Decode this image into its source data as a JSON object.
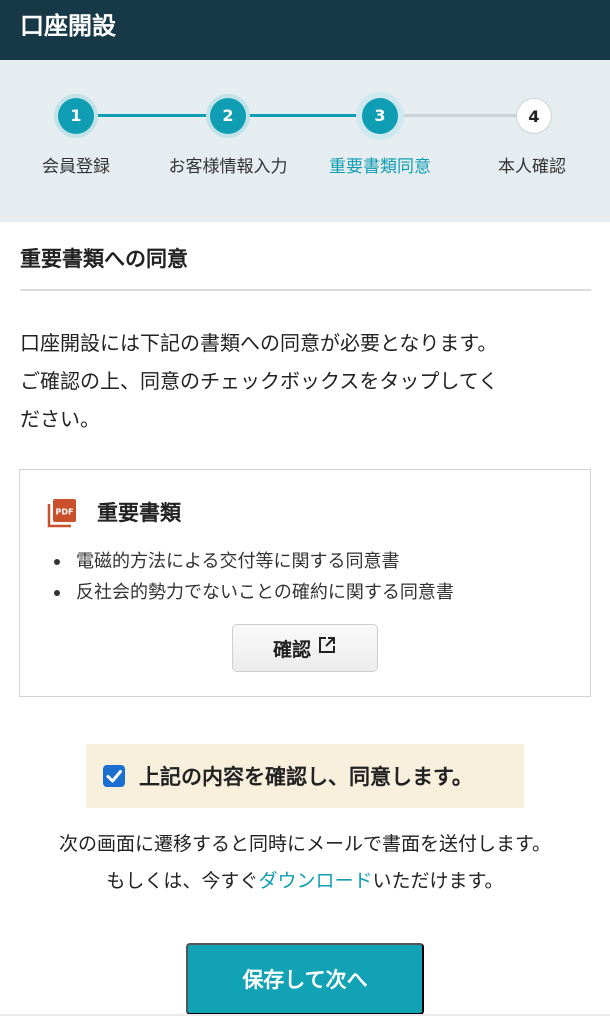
{
  "header": {
    "title": "口座開設"
  },
  "stepper": {
    "steps": [
      {
        "number": "1",
        "label": "会員登録",
        "state": "done"
      },
      {
        "number": "2",
        "label": "お客様情報入力",
        "state": "done"
      },
      {
        "number": "3",
        "label": "重要書類同意",
        "state": "current"
      },
      {
        "number": "4",
        "label": "本人確認",
        "state": "todo"
      }
    ]
  },
  "section": {
    "title": "重要書類への同意"
  },
  "intro": {
    "line1": "口座開設には下記の書類への同意が必要となります。",
    "line2": "ご確認の上、同意のチェックボックスをタップしてく",
    "line3": "ださい。"
  },
  "documents": {
    "icon": "pdf-icon",
    "title": "重要書類",
    "items": [
      "電磁的方法による交付等に関する同意書",
      "反社会的勢力でないことの確約に関する同意書"
    ],
    "confirm_label": "確認",
    "confirm_icon": "external-link-icon"
  },
  "agreement": {
    "checked": true,
    "label": "上記の内容を確認し、同意します。"
  },
  "notice": {
    "line1": "次の画面に遷移すると同時にメールで書面を送付します。",
    "line2_prefix": "もしくは、今すぐ",
    "download_link": "ダウンロード",
    "line2_suffix": "いただけます。"
  },
  "actions": {
    "primary_label": "保存して次へ"
  },
  "colors": {
    "header_bg": "#173847",
    "accent": "#0e9db3",
    "stepper_bg": "#e6edf0",
    "pdf_icon": "#c9502a",
    "checkbox": "#1a6fd0",
    "agree_bg": "#f8efdc"
  }
}
